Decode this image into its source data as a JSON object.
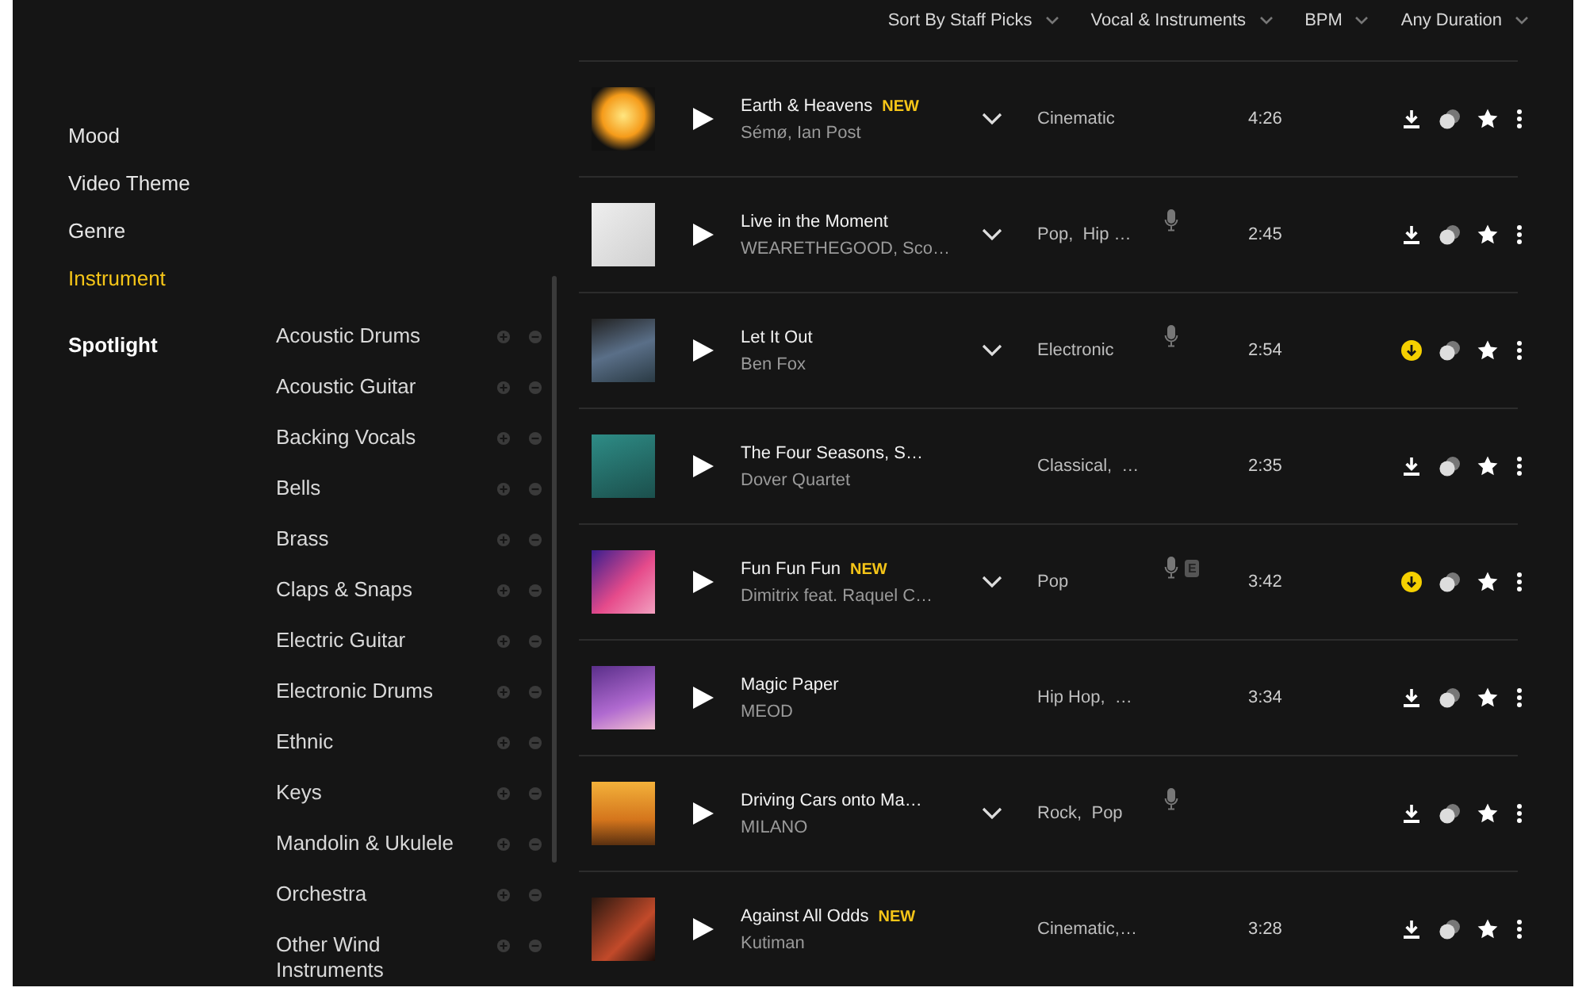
{
  "filters": [
    {
      "label": "Sort By Staff Picks"
    },
    {
      "label": "Vocal & Instruments"
    },
    {
      "label": "BPM"
    },
    {
      "label": "Any Duration"
    }
  ],
  "sidebar": {
    "items": [
      {
        "label": "Mood",
        "selected": false
      },
      {
        "label": "Video Theme",
        "selected": false
      },
      {
        "label": "Genre",
        "selected": false
      },
      {
        "label": "Instrument",
        "selected": true
      }
    ],
    "spotlight": "Spotlight",
    "instruments": [
      {
        "label": "Acoustic Drums"
      },
      {
        "label": "Acoustic Guitar"
      },
      {
        "label": "Backing Vocals"
      },
      {
        "label": "Bells"
      },
      {
        "label": "Brass"
      },
      {
        "label": "Claps & Snaps"
      },
      {
        "label": "Electric Guitar"
      },
      {
        "label": "Electronic Drums"
      },
      {
        "label": "Ethnic"
      },
      {
        "label": "Keys"
      },
      {
        "label": "Mandolin & Ukulele"
      },
      {
        "label": "Orchestra"
      },
      {
        "label": "Other Wind Instruments"
      }
    ]
  },
  "tracks": [
    {
      "title": "Earth & Heavens",
      "new_badge": "NEW",
      "artists": "Sémø, Ian Post",
      "expandable": true,
      "genre": "Cinematic",
      "vocals": false,
      "explicit": false,
      "duration": "4:26",
      "downloaded": false
    },
    {
      "title": "Live in the Moment",
      "artists": "WEARETHEGOOD, Sco…",
      "expandable": true,
      "genre": "Pop,  Hip …",
      "vocals": true,
      "explicit": false,
      "duration": "2:45",
      "downloaded": false
    },
    {
      "title": "Let It Out",
      "artists": "Ben Fox",
      "expandable": true,
      "genre": "Electronic",
      "vocals": true,
      "explicit": false,
      "duration": "2:54",
      "downloaded": true
    },
    {
      "title": "The Four Seasons, S…",
      "artists": "Dover Quartet",
      "expandable": false,
      "genre": "Classical,  …",
      "vocals": false,
      "explicit": false,
      "duration": "2:35",
      "downloaded": false
    },
    {
      "title": "Fun Fun Fun",
      "new_badge": "NEW",
      "artists": "Dimitrix feat. Raquel C…",
      "expandable": true,
      "genre": "Pop",
      "vocals": true,
      "explicit": true,
      "explicit_label": "E",
      "duration": "3:42",
      "downloaded": true
    },
    {
      "title": "Magic Paper",
      "artists": "MEOD",
      "expandable": false,
      "genre": "Hip Hop,  …",
      "vocals": false,
      "explicit": false,
      "duration": "3:34",
      "downloaded": false
    },
    {
      "title": "Driving Cars onto Ma…",
      "artists": "MILANO",
      "expandable": true,
      "genre": "Rock,  Pop",
      "vocals": true,
      "explicit": false,
      "downloaded": false
    },
    {
      "title": "Against All Odds",
      "new_badge": "NEW",
      "artists": "Kutiman",
      "expandable": false,
      "genre": "Cinematic,…",
      "vocals": false,
      "explicit": false,
      "duration": "3:28",
      "downloaded": false
    }
  ]
}
